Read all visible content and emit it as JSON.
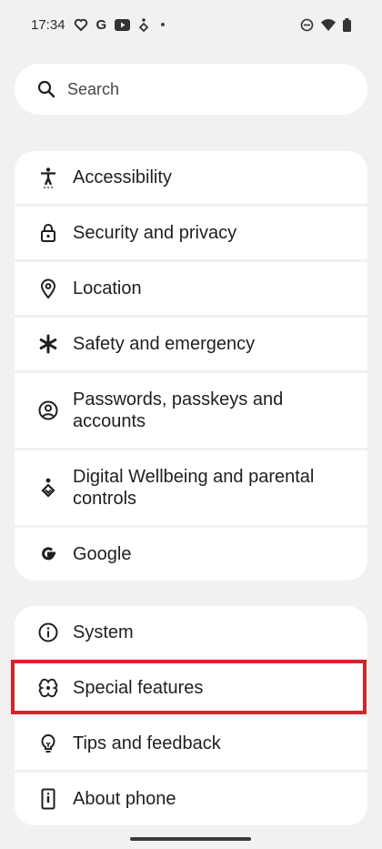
{
  "status_bar": {
    "time": "17:34",
    "notification_icons": [
      "heart-chat-icon",
      "google-g-icon",
      "youtube-icon",
      "wellbeing-icon",
      "more-dot-icon"
    ],
    "google_letter": "G",
    "system_icons": [
      "do-not-disturb-icon",
      "wifi-icon",
      "battery-icon"
    ]
  },
  "search": {
    "label": "Search",
    "icon": "search-icon"
  },
  "group1": {
    "items": [
      {
        "label": "Accessibility",
        "icon": "accessibility-icon"
      },
      {
        "label": "Security and privacy",
        "icon": "lock-icon"
      },
      {
        "label": "Location",
        "icon": "location-pin-icon"
      },
      {
        "label": "Safety and emergency",
        "icon": "asterisk-icon"
      },
      {
        "label": "Passwords, passkeys and accounts",
        "icon": "account-circle-icon"
      },
      {
        "label": "Digital Wellbeing and parental controls",
        "icon": "wellbeing-icon"
      },
      {
        "label": "Google",
        "icon": "google-g-icon"
      }
    ]
  },
  "group2": {
    "items": [
      {
        "label": "System",
        "icon": "info-icon"
      },
      {
        "label": "Special features",
        "icon": "special-features-icon"
      },
      {
        "label": "Tips and feedback",
        "icon": "lightbulb-icon"
      },
      {
        "label": "About phone",
        "icon": "phone-icon"
      }
    ]
  },
  "colors": {
    "background": "#f1f1f1",
    "card": "#ffffff",
    "highlight_border": "#d5242d",
    "text": "#1f1f1f"
  }
}
